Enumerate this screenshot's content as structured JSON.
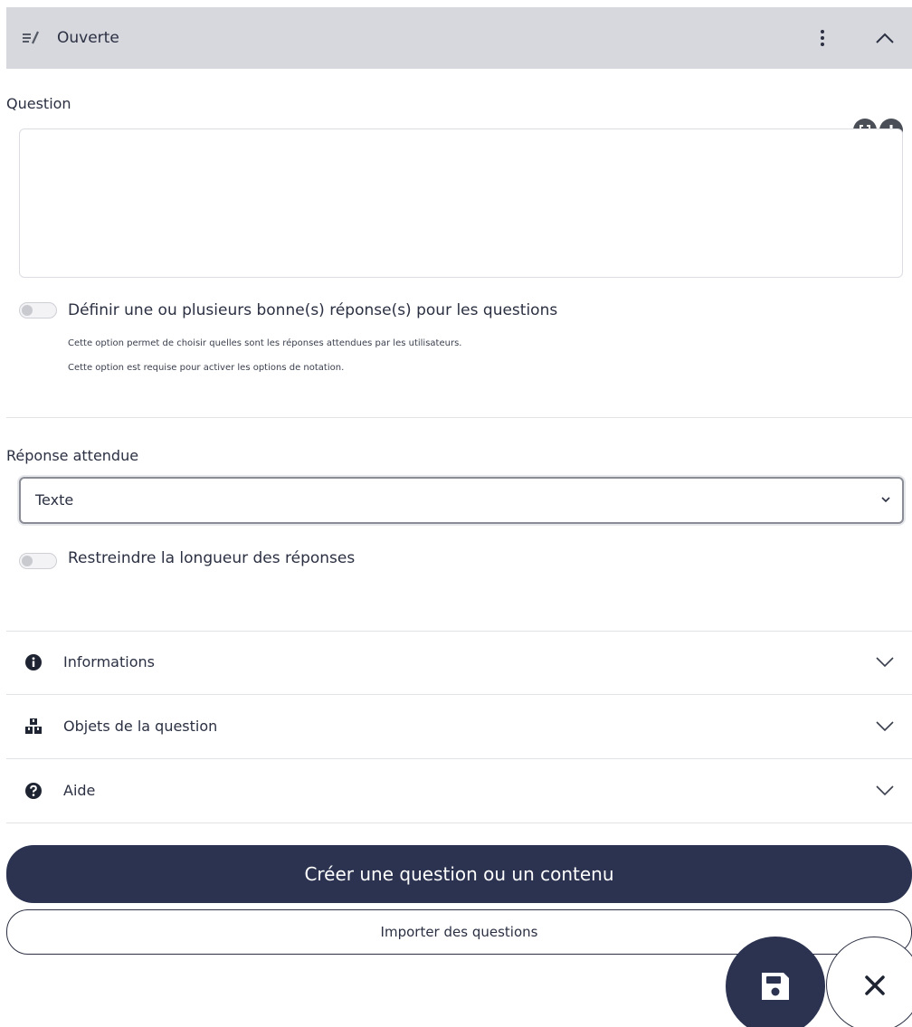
{
  "header": {
    "title": "Ouverte",
    "type_icon": "open-question-icon",
    "menu_icon": "kebab-menu-icon",
    "collapse_icon": "chevron-up-icon"
  },
  "question": {
    "label": "Question",
    "value": "",
    "tools": [
      "fullscreen-icon",
      "add-circle-icon"
    ]
  },
  "correct_answers": {
    "toggle_label": "Définir une ou plusieurs bonne(s) réponse(s) pour les questions",
    "enabled": false,
    "hint_1": "Cette option permet de choisir quelles sont les réponses attendues par les utilisateurs.",
    "hint_2": "Cette option est requise pour activer les options de notation."
  },
  "expected_answer": {
    "label": "Réponse attendue",
    "selected": "Texte"
  },
  "restrict_length": {
    "toggle_label": "Restreindre la longueur des réponses",
    "enabled": false
  },
  "sections": [
    {
      "label": "Informations",
      "icon": "info-icon"
    },
    {
      "label": "Objets de la question",
      "icon": "cubes-icon"
    },
    {
      "label": "Aide",
      "icon": "help-icon"
    }
  ],
  "buttons": {
    "create": "Créer une question ou un contenu",
    "import": "Importer des questions",
    "save_icon": "save-icon",
    "close_icon": "close-icon"
  },
  "colors": {
    "primary": "#2b3350",
    "header_bg": "#d7d8dd"
  }
}
